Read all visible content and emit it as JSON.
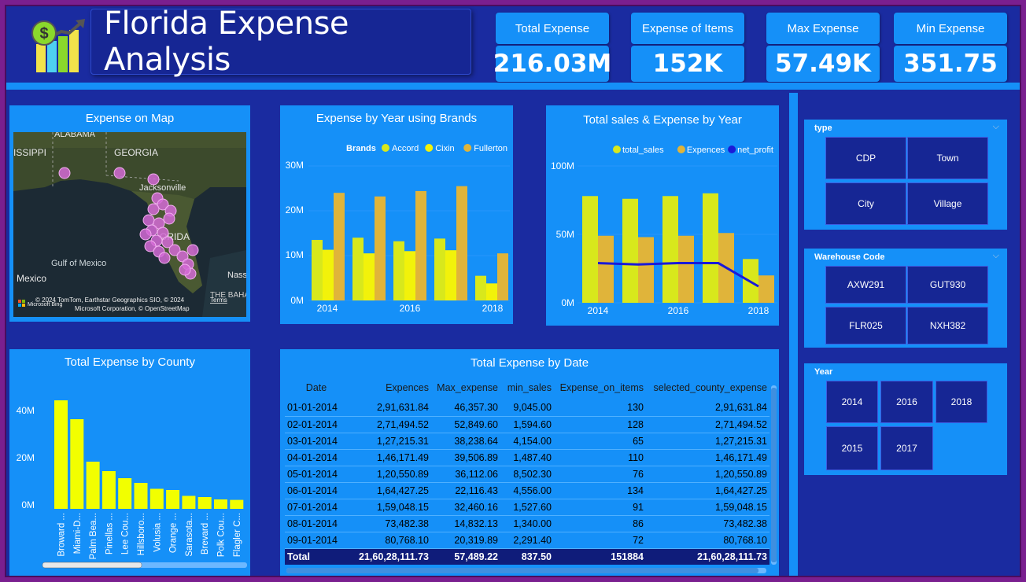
{
  "header": {
    "title": "Florida Expense Analysis"
  },
  "kpis": [
    {
      "label": "Total Expense",
      "value": "216.03M"
    },
    {
      "label": "Expense of Items",
      "value": "152K"
    },
    {
      "label": "Max Expense",
      "value": "57.49K"
    },
    {
      "label": "Min Expense",
      "value": "351.75"
    }
  ],
  "map": {
    "title": "Expense on Map",
    "labels": [
      "ISSIPPI",
      "ALABAMA",
      "GEORGIA",
      "Jacksonville",
      "ORIDA",
      "Gulf of Mexico",
      "Mexico",
      "Nass",
      "THE BAHAM"
    ],
    "attribution": "© 2024 TomTom, Earthstar Geographics SIO, © 2024",
    "attribution2": "Microsoft Corporation, © OpenStreetMap",
    "terms": "Terms",
    "bing": "Microsoft Bing",
    "marker_color": "#d46ad6"
  },
  "brands_chart": {
    "title": "Expense by Year using Brands",
    "legend_title": "Brands",
    "ytick_labels": [
      "30M",
      "20M",
      "10M",
      "0M"
    ],
    "xtick_labels": [
      "2014",
      "2016",
      "2018"
    ]
  },
  "sales_chart": {
    "title": "Total sales & Expense by Year",
    "ytick_labels": [
      "100M",
      "50M",
      "0M"
    ],
    "xtick_labels": [
      "2014",
      "2016",
      "2018"
    ]
  },
  "county_chart": {
    "title": "Total Expense by County",
    "ytick_labels": [
      "40M",
      "20M",
      "0M"
    ]
  },
  "chart_data": [
    {
      "type": "bar",
      "title": "Expense by Year using Brands",
      "legend_title": "Brands",
      "categories": [
        "2014",
        "2015",
        "2016",
        "2017",
        "2018"
      ],
      "series": [
        {
          "name": "Accord",
          "color": "#d8e81c",
          "values": [
            13.5,
            14,
            13.2,
            13.8,
            5.5
          ]
        },
        {
          "name": "Cixin",
          "color": "#f2f20a",
          "values": [
            11.3,
            10.5,
            11,
            11.2,
            3.8
          ]
        },
        {
          "name": "Fullerton",
          "color": "#e0b43a",
          "values": [
            24,
            23.2,
            24.4,
            25.5,
            10.5
          ]
        }
      ],
      "ylim": [
        0,
        30
      ],
      "y_unit": "M"
    },
    {
      "type": "bar",
      "title": "Total sales & Expense by Year",
      "categories": [
        "2014",
        "2015",
        "2016",
        "2017",
        "2018"
      ],
      "series": [
        {
          "name": "total_sales",
          "color": "#d8e81c",
          "values": [
            78,
            76,
            78,
            80,
            32
          ]
        },
        {
          "name": "Expences",
          "color": "#e0b43a",
          "values": [
            49,
            48,
            49,
            51,
            20
          ]
        },
        {
          "name": "net_profit",
          "color": "#1a1ad8",
          "kind": "line",
          "values": [
            29,
            28,
            29,
            29,
            12
          ]
        }
      ],
      "ylim": [
        0,
        100
      ],
      "y_unit": "M"
    },
    {
      "type": "bar",
      "title": "Total Expense by County",
      "categories": [
        "Broward ...",
        "Miami-D...",
        "Palm Bea...",
        "Pinellas ...",
        "Lee Cou...",
        "Hillsboro...",
        "Volusia ...",
        "Orange ...",
        "Sarasota...",
        "Brevard ...",
        "Polk Cou...",
        "Flagler C..."
      ],
      "values": [
        46,
        38,
        20,
        16,
        13,
        11,
        8.5,
        8,
        5.5,
        5,
        4,
        3.8
      ],
      "color": "#f2ff00",
      "ylim": [
        0,
        50
      ],
      "y_unit": "M"
    }
  ],
  "table": {
    "title": "Total Expense by Date",
    "columns": [
      "Date",
      "Expences",
      "Max_expense",
      "min_sales",
      "Expense_on_items",
      "selected_county_expense"
    ],
    "rows": [
      [
        "01-01-2014",
        "2,91,631.84",
        "46,357.30",
        "9,045.00",
        "130",
        "2,91,631.84"
      ],
      [
        "02-01-2014",
        "2,71,494.52",
        "52,849.60",
        "1,594.60",
        "128",
        "2,71,494.52"
      ],
      [
        "03-01-2014",
        "1,27,215.31",
        "38,238.64",
        "4,154.00",
        "65",
        "1,27,215.31"
      ],
      [
        "04-01-2014",
        "1,46,171.49",
        "39,506.89",
        "1,487.40",
        "110",
        "1,46,171.49"
      ],
      [
        "05-01-2014",
        "1,20,550.89",
        "36,112.06",
        "8,502.30",
        "76",
        "1,20,550.89"
      ],
      [
        "06-01-2014",
        "1,64,427.25",
        "22,116.43",
        "4,556.00",
        "134",
        "1,64,427.25"
      ],
      [
        "07-01-2014",
        "1,59,048.15",
        "32,460.16",
        "1,527.60",
        "91",
        "1,59,048.15"
      ],
      [
        "08-01-2014",
        "73,482.38",
        "14,832.13",
        "1,340.00",
        "86",
        "73,482.38"
      ],
      [
        "09-01-2014",
        "80,768.10",
        "20,319.89",
        "2,291.40",
        "72",
        "80,768.10"
      ]
    ],
    "total": [
      "Total",
      "21,60,28,111.73",
      "57,489.22",
      "837.50",
      "151884",
      "21,60,28,111.73"
    ]
  },
  "slicers": {
    "type": {
      "label": "type",
      "options": [
        "CDP",
        "Town",
        "City",
        "Village"
      ]
    },
    "warehouse": {
      "label": "Warehouse Code",
      "options": [
        "AXW291",
        "GUT930",
        "FLR025",
        "NXH382"
      ]
    },
    "year": {
      "label": "Year",
      "options": [
        "2014",
        "2016",
        "2018",
        "2015",
        "2017"
      ]
    }
  }
}
